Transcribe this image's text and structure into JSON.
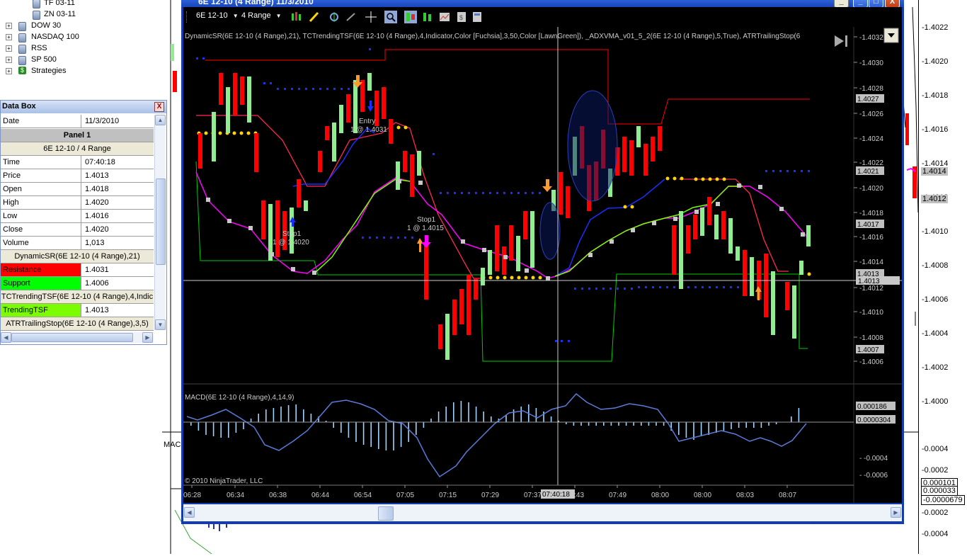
{
  "tree": {
    "items": [
      {
        "label": "TF 03-11",
        "expander": ""
      },
      {
        "label": "ZN 03-11",
        "expander": ""
      },
      {
        "label": "DOW 30",
        "expander": "+"
      },
      {
        "label": "NASDAQ 100",
        "expander": "+"
      },
      {
        "label": "RSS",
        "expander": "+"
      },
      {
        "label": "SP 500",
        "expander": "+"
      },
      {
        "label": "Strategies",
        "expander": "+"
      }
    ]
  },
  "databox": {
    "title": "Data Box",
    "close_glyph": "X",
    "date_label": "Date",
    "date_value": "11/3/2010",
    "panel": "Panel 1",
    "instrument": "6E 12-10 / 4 Range",
    "rows": [
      {
        "label": "Time",
        "value": "07:40:18"
      },
      {
        "label": "Price",
        "value": "1.4013"
      },
      {
        "label": "Open",
        "value": "1.4018"
      },
      {
        "label": "High",
        "value": "1.4020"
      },
      {
        "label": "Low",
        "value": "1.4016"
      },
      {
        "label": "Close",
        "value": "1.4020"
      },
      {
        "label": "Volume",
        "value": "1,013"
      }
    ],
    "dynamic_sr": "DynamicSR(6E 12-10 (4 Range),21)",
    "resistance_label": "Resistance",
    "resistance_value": "1.4031",
    "support_label": "Support",
    "support_value": "1.4006",
    "tc_trending": "TCTrendingTSF(6E 12-10 (4 Range),4,Indic",
    "trending_label": "TrendingTSF",
    "trending_value": "1.4013",
    "atr": "ATRTrailingStop(6E 12-10 (4 Range),3,5)",
    "colors": {
      "resistance": "#ff0000",
      "support": "#00ff00",
      "trending": "#7cfc00"
    }
  },
  "window": {
    "title": "6E 12-10 (4 Range)  11/3/2010",
    "minimize": "_",
    "maximize": "□",
    "close": "X",
    "instrument_combo": "6E 12-10",
    "period_combo": "4 Range"
  },
  "chart": {
    "indicators_line": "DynamicSR(6E 12-10 (4 Range),21), TCTrendingTSF(6E 12-10 (4 Range),4,Indicator,Color [Fuchsia],3,50,Color [LawnGreen]), _ADXVMA_v01_5_2(6E 12-10 (4 Range),5,True), ATRTrailingStop(6",
    "macd_label": "MACD(6E 12-10 (4 Range),4,14,9)",
    "copyright": "© 2010 NinjaTrader, LLC",
    "entry_text": "Entry",
    "entry_price": "1 @ 1.4031",
    "stop1a_text": "Stop1",
    "stop1a_price": "1 @ 1.4020",
    "stop1b_text": "Stop1",
    "stop1b_price": "1 @ 1.4015",
    "price_axis": [
      "1.4032",
      "1.4030",
      "1.4028",
      "1.4026",
      "1.4024",
      "1.4022",
      "1.4020",
      "1.4018",
      "1.4016",
      "1.4014",
      "1.4012",
      "1.4010",
      "1.4008",
      "1.4006"
    ],
    "price_tags": [
      "1.4027",
      "1.4021",
      "1.4017",
      "1.4013",
      "1.4013",
      "1.4007"
    ],
    "cursor_price": "1.4013",
    "macd_axis": [
      "-0.0004",
      "-0.0006"
    ],
    "macd_tags": [
      "0.000186",
      "0.0000304"
    ],
    "time_labels": [
      "06:28",
      "06:34",
      "06:38",
      "06:44",
      "06:54",
      "07:05",
      "07:15",
      "07:29",
      "07:37",
      "07:43",
      "07:49",
      "08:00",
      "08:00",
      "08:03",
      "08:07"
    ],
    "cursor_time": "07:40:18"
  },
  "outer_axis": {
    "labels": [
      "1.4022",
      "1.4020",
      "1.4018",
      "1.4016",
      "1.4014",
      "1.4012",
      "1.4010",
      "1.4008",
      "1.4006",
      "1.4004",
      "1.4002",
      "1.4000",
      "0.0004",
      "0.0002",
      "-0.0002",
      "-0.0004"
    ],
    "tags": [
      "1.4014",
      "1.4012",
      "0.000101",
      "0.000033",
      "-0.0000679"
    ],
    "macd_label": "MAC"
  }
}
